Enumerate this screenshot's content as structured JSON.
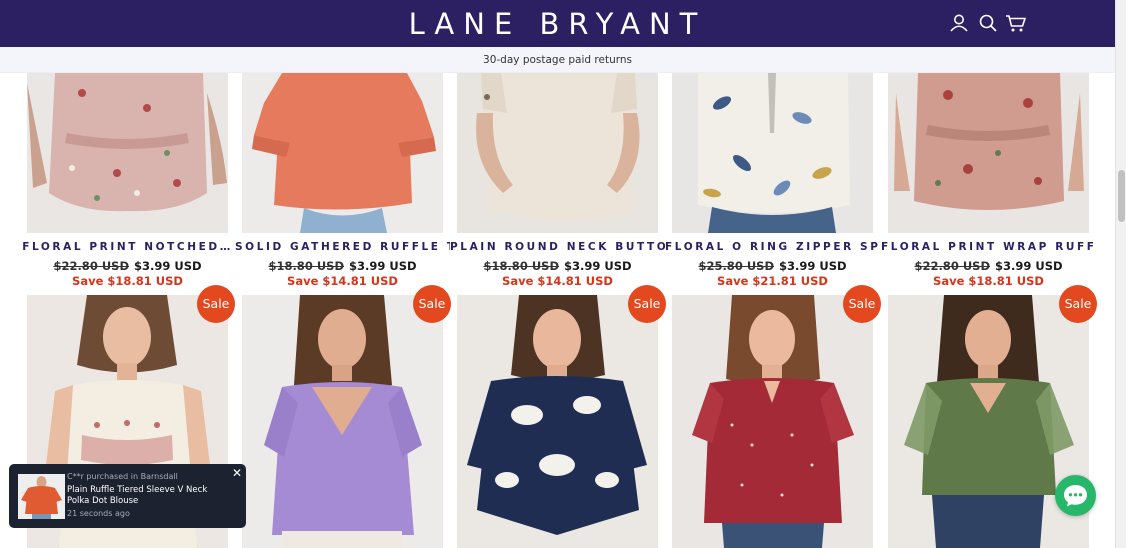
{
  "header": {
    "logo": "LANE BRYANT",
    "account_icon": "account-icon",
    "search_icon": "search-icon",
    "cart_icon": "cart-icon"
  },
  "announcement": "30-day postage paid returns",
  "colors": {
    "header_bg": "#2c2062",
    "title_color": "#2c2062",
    "sale_red": "#d8341a",
    "badge_orange": "#e4481e",
    "chat_green": "#27b76a"
  },
  "row1": [
    {
      "title": "FLORAL PRINT NOTCHED…",
      "old_price": "$22.80 USD",
      "price": "$3.99 USD",
      "save": "Save $18.81 USD"
    },
    {
      "title": "SOLID GATHERED RUFFLE TRIM…",
      "old_price": "$18.80 USD",
      "price": "$3.99 USD",
      "save": "Save $14.81 USD"
    },
    {
      "title": "PLAIN ROUND NECK BUTTON…",
      "old_price": "$18.80 USD",
      "price": "$3.99 USD",
      "save": "Save $14.81 USD"
    },
    {
      "title": "FLORAL O RING ZIPPER SPLIT…",
      "old_price": "$25.80 USD",
      "price": "$3.99 USD",
      "save": "Save $21.81 USD"
    },
    {
      "title": "FLORAL PRINT WRAP RUFFLES…",
      "old_price": "$22.80 USD",
      "price": "$3.99 USD",
      "save": "Save $18.81 USD"
    }
  ],
  "row2": [
    {
      "badge": "Sale"
    },
    {
      "badge": "Sale"
    },
    {
      "badge": "Sale"
    },
    {
      "badge": "Sale"
    },
    {
      "badge": "Sale"
    }
  ],
  "toast": {
    "meta": "C**r purchased in Barnsdall",
    "product": "Plain Ruffle Tiered Sleeve V Neck Polka Dot Blouse",
    "time": "21 seconds ago",
    "close_icon": "close-icon"
  },
  "chat": {
    "icon": "chat-icon"
  }
}
